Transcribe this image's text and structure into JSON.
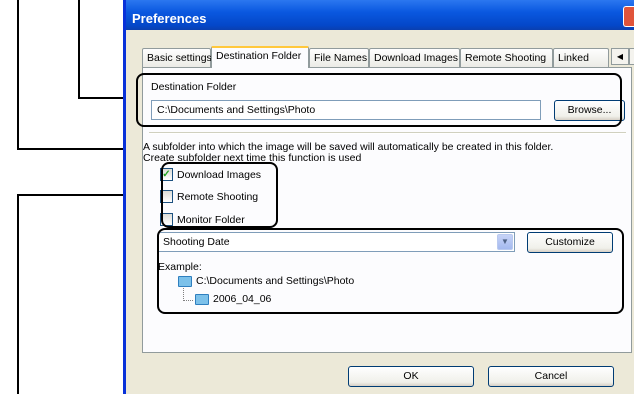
{
  "window": {
    "title": "Preferences"
  },
  "tabs": [
    {
      "label": "Basic settings"
    },
    {
      "label": "Destination Folder"
    },
    {
      "label": "File Names"
    },
    {
      "label": "Download Images"
    },
    {
      "label": "Remote Shooting"
    },
    {
      "label": "Linked"
    }
  ],
  "tab_scroll": {
    "left": "◀",
    "right": "▶"
  },
  "destination": {
    "group_label": "Destination Folder",
    "path_value": "C:\\Documents and Settings\\Photo",
    "browse_label": "Browse..."
  },
  "subfolder": {
    "info_text": "A subfolder into which the image will be saved will automatically be created in this folder.",
    "create_label": "Create subfolder next time this function is used",
    "options": [
      {
        "label": "Download Images",
        "checked": true
      },
      {
        "label": "Remote Shooting",
        "checked": false
      },
      {
        "label": "Monitor Folder",
        "checked": false
      }
    ],
    "naming_selected": "Shooting Date",
    "customize_label": "Customize",
    "example_label": "Example:",
    "example_parent": "C:\\Documents and Settings\\Photo",
    "example_child": "2006_04_06"
  },
  "footer": {
    "ok_label": "OK",
    "cancel_label": "Cancel"
  }
}
